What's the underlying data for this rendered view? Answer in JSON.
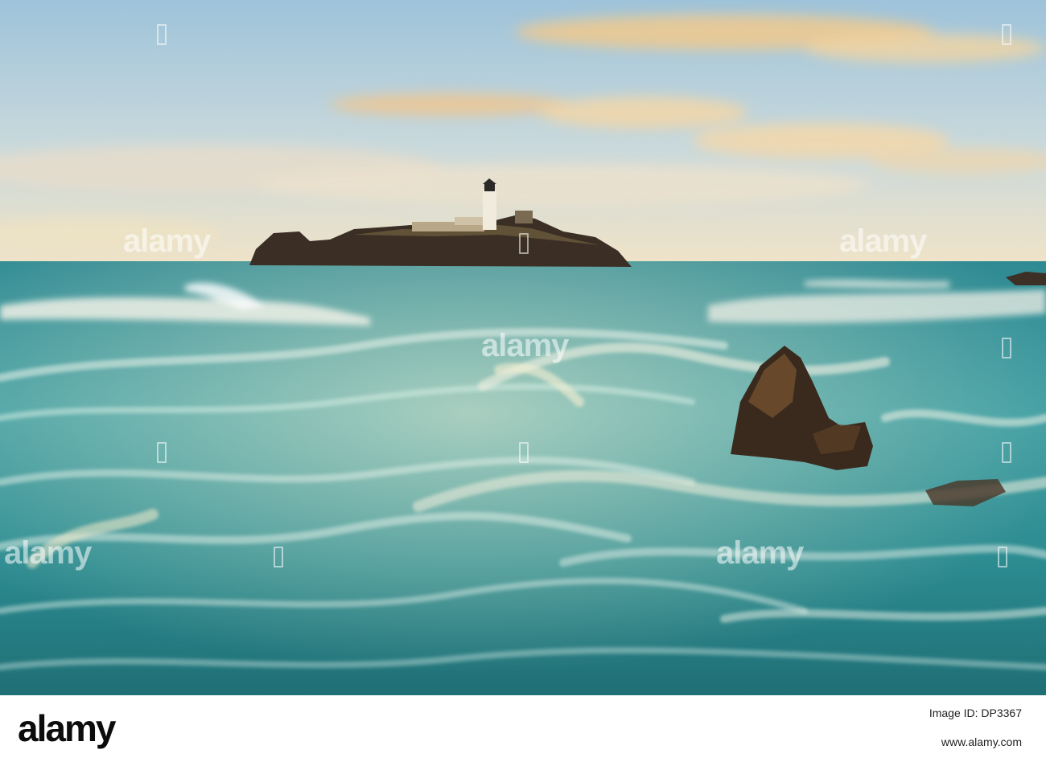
{
  "photo": {
    "subject": "",
    "watermark_text": "alamy"
  },
  "footer": {
    "brand": "alamy",
    "image_id": "Image ID: DP3367",
    "site_url": "www.alamy.com"
  },
  "colors": {
    "sky_top": "#a9c8dd",
    "sky_horizon": "#efe2c9",
    "cloud": "#f1c98e",
    "sea_deep": "#1e7a86",
    "sea_light": "#6fc3bf",
    "foam": "#f4f1e6",
    "rock": "#3a2d22"
  }
}
